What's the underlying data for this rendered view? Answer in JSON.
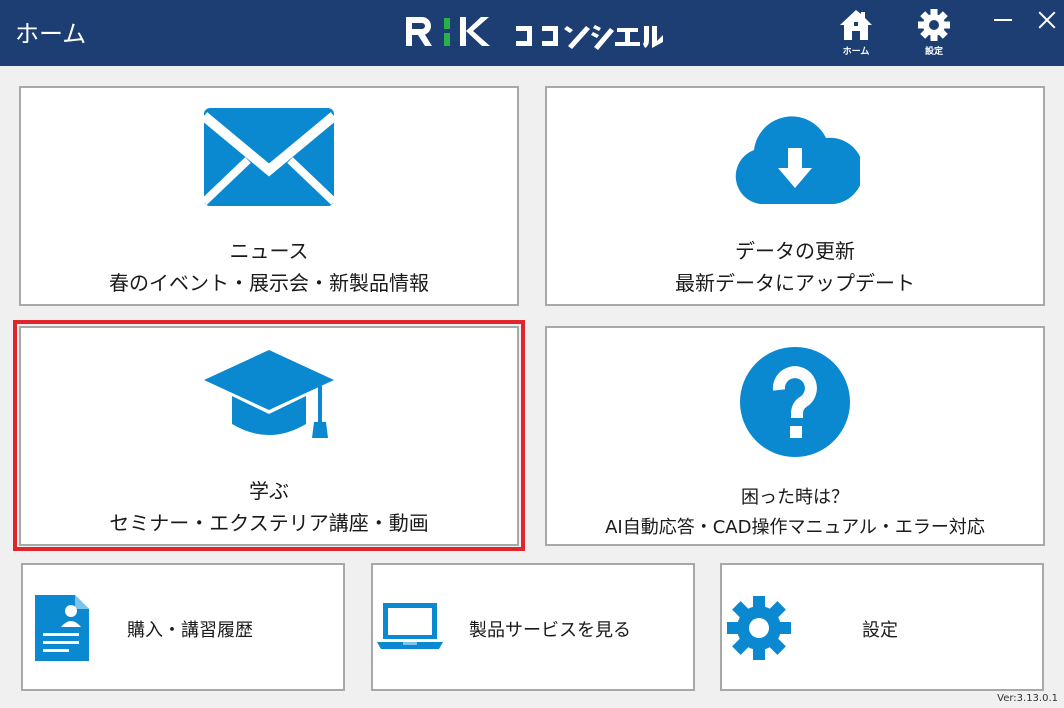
{
  "window": {
    "title": "ホーム",
    "brand": "R:K コンシェル"
  },
  "toolbar": {
    "home_label": "ホーム",
    "settings_label": "設定"
  },
  "tiles": [
    {
      "title": "ニュース",
      "subtitle": "春のイベント・展示会・新製品情報",
      "icon": "mail-icon"
    },
    {
      "title": "データの更新",
      "subtitle": "最新データにアップデート",
      "icon": "cloud-download-icon"
    },
    {
      "title": "学ぶ",
      "subtitle": "セミナー・エクステリア講座・動画",
      "icon": "graduation-cap-icon"
    },
    {
      "title": "困った時は？",
      "subtitle": "AI自動応答・CAD操作マニュアル・エラー対応",
      "icon": "question-icon"
    }
  ],
  "small_tiles": [
    {
      "label": "購入・講習履歴",
      "icon": "document-icon"
    },
    {
      "label": "製品サービスを見る",
      "icon": "laptop-icon"
    },
    {
      "label": "設定",
      "icon": "gear-icon"
    }
  ],
  "version": "Ver:3.13.0.1",
  "colors": {
    "titlebar": "#1d3e72",
    "accent": "#0a88d0",
    "selection": "#e0252b"
  }
}
